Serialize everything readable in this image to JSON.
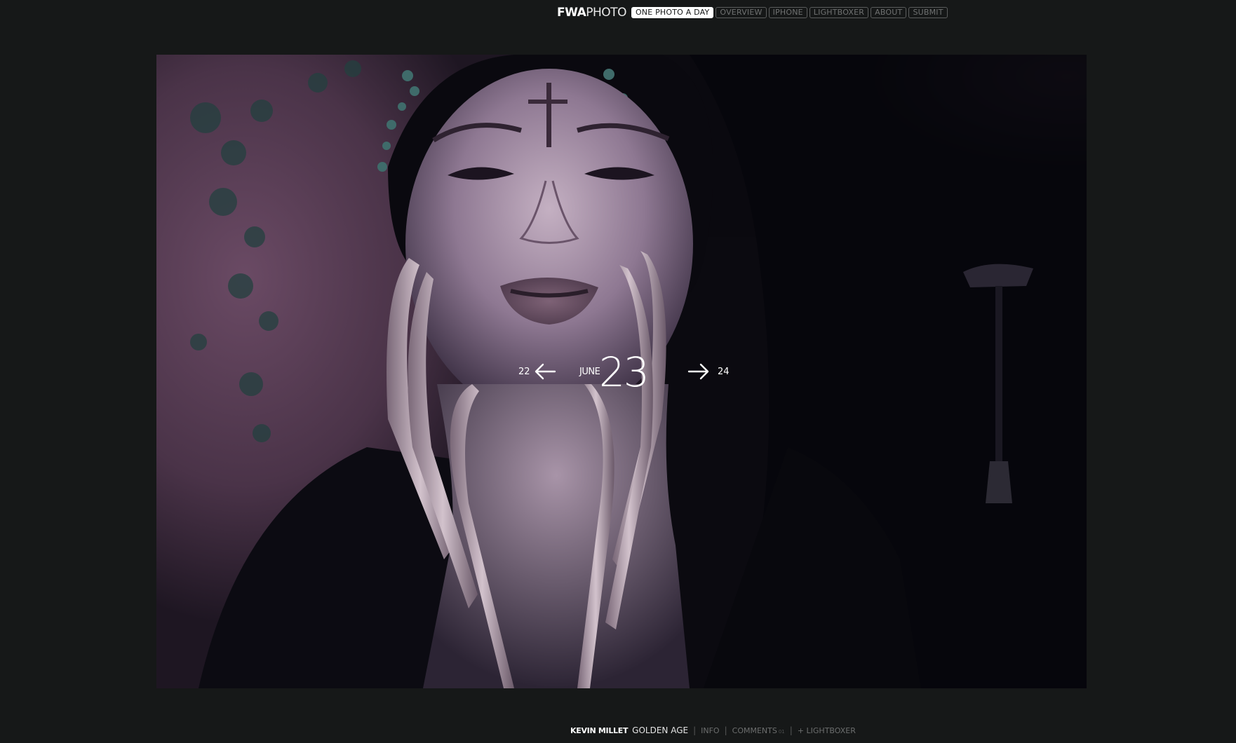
{
  "header": {
    "logo_bold": "FWA",
    "logo_light": "PHOTO",
    "nav": [
      {
        "label": "ONE PHOTO A DAY",
        "active": true
      },
      {
        "label": "OVERVIEW",
        "active": false
      },
      {
        "label": "IPHONE",
        "active": false
      },
      {
        "label": "LIGHTBOXER",
        "active": false
      },
      {
        "label": "ABOUT",
        "active": false
      },
      {
        "label": "SUBMIT",
        "active": false
      }
    ]
  },
  "date_nav": {
    "prev_day": "22",
    "month": "JUNE",
    "day": "23",
    "next_day": "24"
  },
  "photo": {
    "subject": "portrait of woman with cross on forehead and long metal finger claws"
  },
  "footer": {
    "author": "KEVIN MILLET",
    "title": "GOLDEN AGE",
    "info_label": "INFO",
    "comments_label": "COMMENTS",
    "comments_count": "01",
    "lightbox_label": "+ LIGHTBOXER",
    "separator": "|"
  },
  "colors": {
    "background": "#161818",
    "nav_border": "#5a5c5c",
    "nav_text": "#6f7171",
    "active_bg": "#ffffff"
  }
}
